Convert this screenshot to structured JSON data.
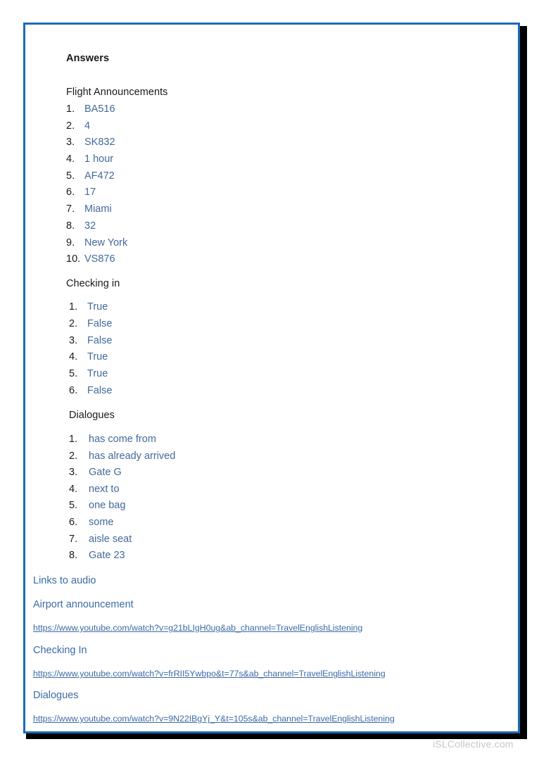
{
  "document": {
    "title": "Answers",
    "sections": [
      {
        "heading": "Flight Announcements",
        "answers": [
          {
            "num": "1.",
            "text": "BA516"
          },
          {
            "num": "2.",
            "text": "4"
          },
          {
            "num": "3.",
            "text": "SK832"
          },
          {
            "num": "4.",
            "text": "1 hour"
          },
          {
            "num": "5.",
            "text": "AF472"
          },
          {
            "num": "6.",
            "text": "17"
          },
          {
            "num": "7.",
            "text": "Miami"
          },
          {
            "num": "8.",
            "text": "32"
          },
          {
            "num": "9.",
            "text": "New York"
          },
          {
            "num": "10.",
            "text": "VS876"
          }
        ]
      },
      {
        "heading": "Checking in",
        "answers": [
          {
            "num": "1.",
            "text": "True"
          },
          {
            "num": "2.",
            "text": "False"
          },
          {
            "num": "3.",
            "text": "False"
          },
          {
            "num": "4.",
            "text": "True"
          },
          {
            "num": "5.",
            "text": "True"
          },
          {
            "num": "6.",
            "text": "False"
          }
        ]
      },
      {
        "heading": "Dialogues",
        "answers": [
          {
            "num": "1.",
            "text": "has come from"
          },
          {
            "num": "2.",
            "text": "has already arrived"
          },
          {
            "num": "3.",
            "text": "Gate G"
          },
          {
            "num": "4.",
            "text": "next to"
          },
          {
            "num": "5.",
            "text": "one bag"
          },
          {
            "num": "6.",
            "text": "some"
          },
          {
            "num": "7.",
            "text": "aisle seat"
          },
          {
            "num": "8.",
            "text": "Gate 23"
          }
        ]
      }
    ],
    "links_section": {
      "heading": "Links to audio",
      "entries": [
        {
          "label": "Airport announcement",
          "url": "https://www.youtube.com/watch?v=g21bLIgH0ug&ab_channel=TravelEnglishListening"
        },
        {
          "label": "Checking In",
          "url": "https://www.youtube.com/watch?v=frRII5Ywbpo&t=77s&ab_channel=TravelEnglishListening"
        },
        {
          "label": "Dialogues",
          "url": "https://www.youtube.com/watch?v=9N22IBgYj_Y&t=105s&ab_channel=TravelEnglishListening"
        }
      ]
    }
  },
  "watermark": {
    "text": "iSLCollective.com"
  },
  "colors": {
    "border_blue": "#1b6cb5",
    "answer_blue": "#42699b",
    "link_blue": "#3c6ba5",
    "heading_black": "#1a1a1a",
    "watermark_gray": "#c6c6c6"
  }
}
